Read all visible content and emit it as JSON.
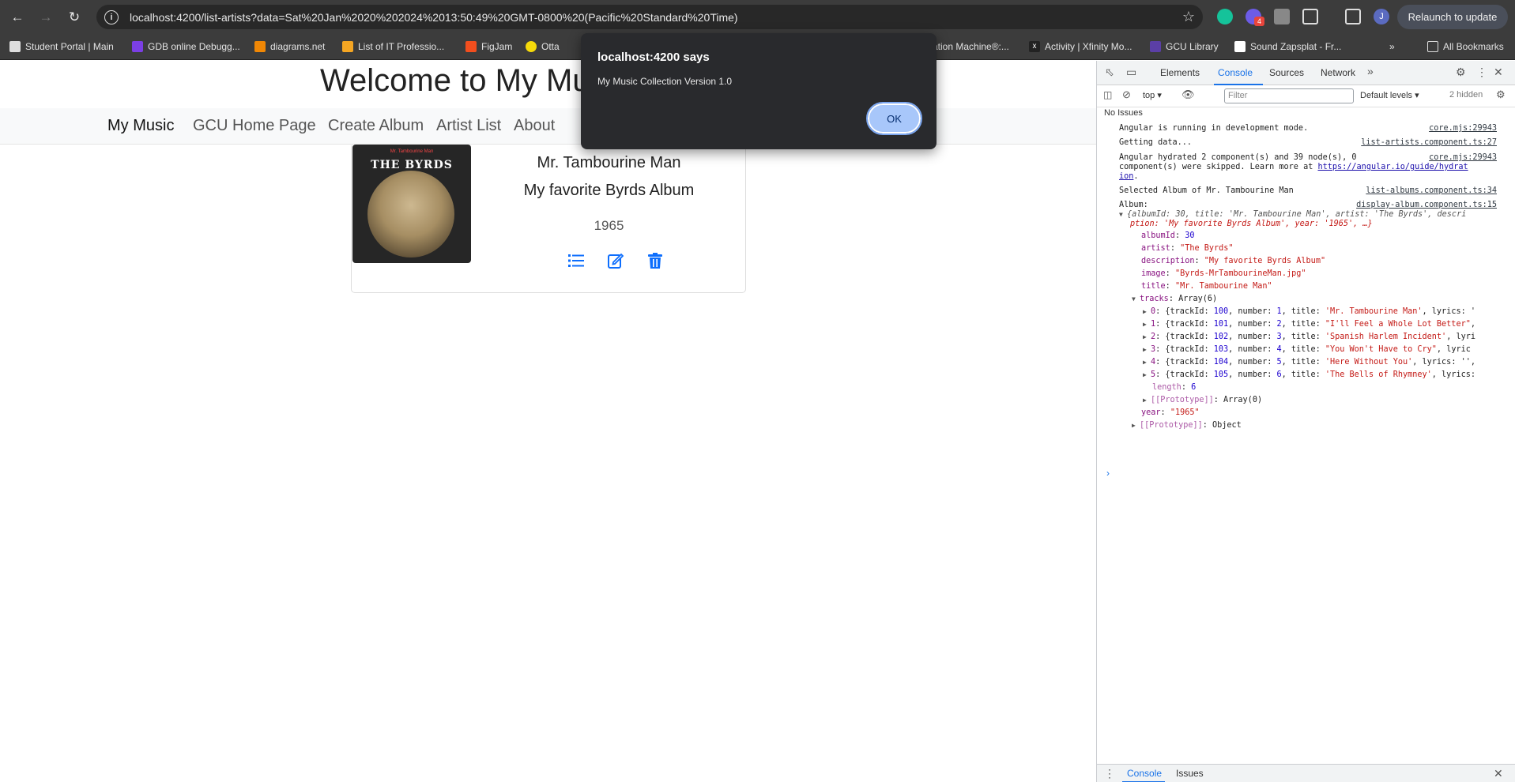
{
  "browser": {
    "url": "localhost:4200/list-artists?data=Sat%20Jan%2020%202024%2013:50:49%20GMT-0800%20(Pacific%20Standard%20Time)",
    "relaunch_label": "Relaunch to update",
    "profile_initial": "J",
    "extension_badge": "4",
    "bookmarks": [
      {
        "label": "Student Portal | Main",
        "color": "#dddddd"
      },
      {
        "label": "GDB online Debugg...",
        "color": "#7b3fe4"
      },
      {
        "label": "diagrams.net",
        "color": "#f08705"
      },
      {
        "label": "List of IT Professio...",
        "color": "#f5a623"
      },
      {
        "label": "FigJam",
        "color": "#f24e1e"
      },
      {
        "label": "Otta",
        "color": "#f5d90a"
      },
      {
        "label": "ation Machine®:...",
        "color": "#3c3c3c"
      },
      {
        "label": "Activity | Xfinity Mo...",
        "color": "#222222"
      },
      {
        "label": "GCU Library",
        "color": "#5b3fa6"
      },
      {
        "label": "Sound Zapsplat - Fr...",
        "color": "#111111"
      }
    ],
    "all_bookmarks_label": "All Bookmarks"
  },
  "page": {
    "welcome_title": "Welcome to My Mu",
    "nav": {
      "brand": "My Music",
      "links": [
        "GCU Home Page",
        "Create Album",
        "Artist List",
        "About"
      ]
    },
    "album": {
      "cover_band": "THE BYRDS",
      "cover_subtitle": "Mr. Tambourine Man",
      "title": "Mr. Tambourine Man",
      "description": "My favorite Byrds Album",
      "year": "1965"
    }
  },
  "dialog": {
    "title": "localhost:4200 says",
    "message": "My Music Collection Version 1.0",
    "ok_label": "OK"
  },
  "devtools": {
    "tabs": [
      "Elements",
      "Console",
      "Sources",
      "Network"
    ],
    "context": "top",
    "filter_placeholder": "Filter",
    "levels": "Default levels",
    "hidden": "2 hidden",
    "no_issues": "No Issues",
    "drawer_tabs": [
      "Console",
      "Issues"
    ],
    "messages": [
      {
        "text": "Angular is running in development mode.",
        "source": "core.mjs:29943"
      },
      {
        "text": "Getting data...",
        "source": "list-artists.component.ts:27"
      },
      {
        "text": "Angular hydrated 2 component(s) and 39 node(s), 0",
        "source": "core.mjs:29943"
      },
      {
        "text": "component(s) were skipped. Learn more at ",
        "link": "https://angular.io/guide/hydrat"
      },
      {
        "text": "ion",
        "link": "ion"
      },
      {
        "text": "Selected Album of Mr. Tambourine Man",
        "source": "list-albums.component.ts:34"
      },
      {
        "text": "Album:",
        "source": "display-album.component.ts:15"
      }
    ],
    "album_object": {
      "summary_1": "{albumId: 30, title: 'Mr. Tambourine Man', artist: 'The Byrds', descri",
      "summary_2": "ption: 'My favorite Byrds Album', year: '1965', …}",
      "albumId": "30",
      "artist": "\"The Byrds\"",
      "description": "\"My favorite Byrds Album\"",
      "image": "\"Byrds-MrTambourineMan.jpg\"",
      "title": "\"Mr. Tambourine Man\"",
      "tracks_label": "Array(6)",
      "tracks": [
        {
          "index": "0",
          "id": "100",
          "number": "1",
          "title": "'Mr. Tambourine Man'",
          "tail": ", lyrics: '"
        },
        {
          "index": "1",
          "id": "101",
          "number": "2",
          "title": "\"I'll Feel a Whole Lot Better\"",
          "tail": ","
        },
        {
          "index": "2",
          "id": "102",
          "number": "3",
          "title": "'Spanish Harlem Incident'",
          "tail": ", lyri"
        },
        {
          "index": "3",
          "id": "103",
          "number": "4",
          "title": "\"You Won't Have to Cry\"",
          "tail": ", lyric"
        },
        {
          "index": "4",
          "id": "104",
          "number": "5",
          "title": "'Here Without You'",
          "tail": ", lyrics: '',"
        },
        {
          "index": "5",
          "id": "105",
          "number": "6",
          "title": "'The Bells of Rhymney'",
          "tail": ", lyrics:"
        }
      ],
      "length": "6",
      "array_proto": "Array(0)",
      "year": "\"1965\"",
      "object_proto": "Object"
    }
  }
}
